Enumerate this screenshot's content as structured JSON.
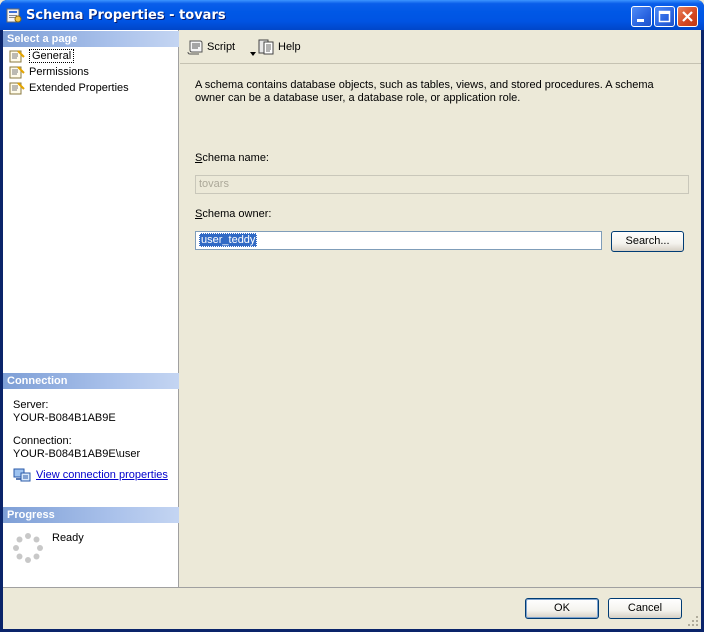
{
  "window": {
    "title": "Schema Properties - tovars"
  },
  "left": {
    "select_page_header": "Select a page",
    "pages": [
      {
        "label": "General",
        "selected": true
      },
      {
        "label": "Permissions",
        "selected": false
      },
      {
        "label": "Extended Properties",
        "selected": false
      }
    ],
    "connection_header": "Connection",
    "server_label": "Server:",
    "server_value": "YOUR-B084B1AB9E",
    "connection_label": "Connection:",
    "connection_value": "YOUR-B084B1AB9E\\user",
    "view_connection_link": "View connection properties",
    "progress_header": "Progress",
    "progress_status": "Ready"
  },
  "toolbar": {
    "script_label": "Script",
    "help_label": "Help"
  },
  "main": {
    "description": "A schema contains database objects, such as tables, views, and stored procedures. A schema owner can be a database user, a database role, or application role.",
    "schema_name_label_hotkey": "S",
    "schema_name_label_rest": "chema name:",
    "schema_name_value": "tovars",
    "schema_owner_label_hotkey": "S",
    "schema_owner_label_rest": "chema owner:",
    "schema_owner_value": "user_teddy",
    "search_button": "Search..."
  },
  "footer": {
    "ok_label": "OK",
    "cancel_label": "Cancel"
  },
  "colors": {
    "titlebar": "#0054E3",
    "section_header": "#7E9FD6",
    "selection": "#316AC5",
    "dialog_bg": "#ECE9D8"
  }
}
